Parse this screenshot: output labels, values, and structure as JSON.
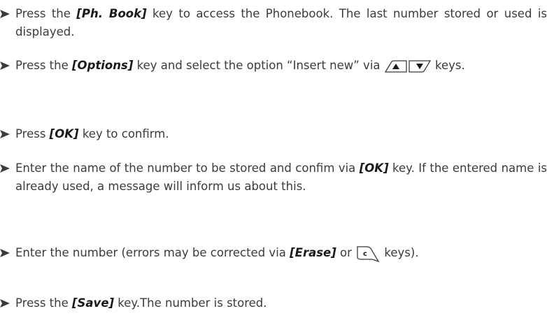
{
  "colors": {
    "text": "#3b3b3b",
    "bullet": "#3b3b3b"
  },
  "steps": [
    {
      "pre": "Press the ",
      "key": "[Ph. Book]",
      "post": " key to access the Phonebook. The last number stored or used is displayed."
    },
    {
      "pre": "Press the ",
      "key": "[Options]",
      "mid": " key and select the option “Insert new” via ",
      "icons": [
        "up-arrow-key-icon",
        "down-arrow-key-icon"
      ],
      "post": " keys."
    },
    {
      "pre": "Press ",
      "key": "[OK]",
      "post": " key to confirm."
    },
    {
      "pre": "Enter the name of the number to be stored and confim via ",
      "key": "[OK]",
      "post": " key. If the entered name is already used, a message will inform us about this."
    },
    {
      "pre": "Enter the number (errors may be corrected via ",
      "key": "[Erase]",
      "mid": " or ",
      "icons": [
        "c-clear-key-icon"
      ],
      "post": " keys)."
    },
    {
      "pre": "Press the ",
      "key": "[Save]",
      "post": " key.The number is stored."
    }
  ]
}
